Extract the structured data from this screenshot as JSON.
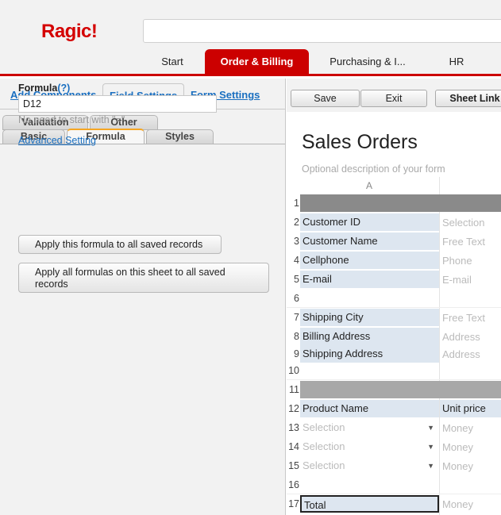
{
  "app": {
    "logo": "Ragic!"
  },
  "nav_tabs": [
    {
      "label": "Start",
      "active": false
    },
    {
      "label": "Order & Billing",
      "active": true
    },
    {
      "label": "Purchasing & I...",
      "active": false
    },
    {
      "label": "HR",
      "active": false
    }
  ],
  "panel_tabs": [
    {
      "label": "Add Components",
      "active": false
    },
    {
      "label": "Field Settings",
      "active": true
    },
    {
      "label": "Form Settings",
      "active": false
    }
  ],
  "sub_tabs_back": [
    {
      "label": "Validation"
    },
    {
      "label": "Other"
    }
  ],
  "sub_tabs_front": [
    {
      "label": "Basic",
      "active": false
    },
    {
      "label": "Formula",
      "active": true
    },
    {
      "label": "Styles",
      "active": false
    }
  ],
  "formula": {
    "label": "Formula",
    "help": "(?)",
    "value": "D12",
    "hint": "No need to start with \"=\"",
    "advanced_link": "Advanced Setting",
    "apply_one_button": "Apply this formula to all saved records",
    "apply_all_button": "Apply all formulas on this sheet to all saved records"
  },
  "toolbar": {
    "save": "Save",
    "exit": "Exit",
    "sheet_link": "Sheet Link"
  },
  "sheet": {
    "title": "Sales Orders",
    "description": "Optional description of your form",
    "column_a": "A",
    "rows": [
      {
        "num": "1",
        "kind": "section-dark"
      },
      {
        "num": "2",
        "label": "Customer ID",
        "type": "Selection"
      },
      {
        "num": "3",
        "label": "Customer Name",
        "type": "Free Text"
      },
      {
        "num": "4",
        "label": "Cellphone",
        "type": "Phone"
      },
      {
        "num": "5",
        "label": "E-mail",
        "type": "E-mail"
      },
      {
        "num": "6",
        "kind": "empty"
      },
      {
        "num": "7",
        "label": "Shipping City",
        "type": "Free Text"
      },
      {
        "num": "8",
        "label": "Billing Address",
        "type": "Address"
      },
      {
        "num": "9",
        "label": "Shipping Address",
        "type": "Address"
      },
      {
        "num": "10",
        "kind": "empty"
      },
      {
        "num": "11",
        "kind": "section-mid"
      },
      {
        "num": "12",
        "label": "Product Name",
        "type": "Unit price"
      },
      {
        "num": "13",
        "select": "Selection",
        "type": "Money"
      },
      {
        "num": "14",
        "select": "Selection",
        "type": "Money"
      },
      {
        "num": "15",
        "select": "Selection",
        "type": "Money"
      },
      {
        "num": "16",
        "kind": "empty"
      },
      {
        "num": "17",
        "label": "Total",
        "type": "Money"
      }
    ]
  }
}
